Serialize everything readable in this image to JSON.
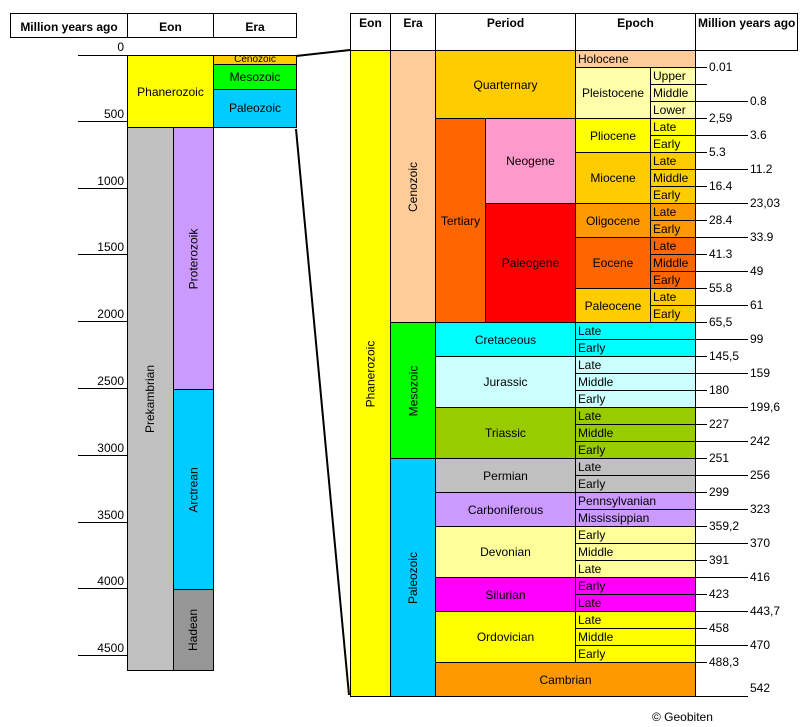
{
  "left": {
    "headers": [
      "Million years ago",
      "Eon",
      "Era"
    ],
    "ticks": [
      0,
      500,
      1000,
      1500,
      2000,
      2500,
      3000,
      3500,
      4000,
      4500
    ],
    "eons": [
      {
        "name": "Phanerozoic",
        "from": 0,
        "to": 542,
        "color": "#FFFF00"
      },
      {
        "name": "Prekambrian",
        "from": 542,
        "to": 4600,
        "color": "#C0C0C0",
        "vertical": true
      }
    ],
    "subeons": [
      {
        "name": "Proterozoik",
        "from": 542,
        "to": 2500,
        "color": "#CC99FF"
      },
      {
        "name": "Arctrean",
        "from": 2500,
        "to": 4000,
        "color": "#00CCFF"
      },
      {
        "name": "Hadean",
        "from": 4000,
        "to": 4600,
        "color": "#969696"
      }
    ],
    "eras": [
      {
        "name": "Cenozoic",
        "from": 0,
        "to": 65.5,
        "color": "#FFCC00"
      },
      {
        "name": "Mesozoic",
        "from": 65.5,
        "to": 251,
        "color": "#00FF00"
      },
      {
        "name": "Paleozoic",
        "from": 251,
        "to": 542,
        "color": "#00CCFF"
      }
    ]
  },
  "right": {
    "headers": {
      "eon": "Eon",
      "era": "Era",
      "period": "Period",
      "epoch": "Epoch",
      "mya": "Million years ago"
    },
    "eon": {
      "name": "Phanerozoic",
      "color": "#FFFF00"
    },
    "eras": [
      {
        "name": "Cenozoic",
        "color": "#FFCC99",
        "periods": [
          {
            "name": "Quarternary",
            "color": "#FFCC00",
            "epochs": [
              {
                "name": "Holocene",
                "color": "#FFCC99",
                "subs": []
              },
              {
                "name": "Pleistocene",
                "color": "#FFFFAA",
                "subs": [
                  "Upper",
                  "Middle",
                  "Lower"
                ]
              }
            ]
          },
          {
            "name": "Neogene",
            "group": "Tertiary",
            "groupColor": "#FF6600",
            "color": "#FF99CC",
            "epochs": [
              {
                "name": "Pliocene",
                "color": "#FFFF00",
                "subs": [
                  "Late",
                  "Early"
                ]
              },
              {
                "name": "Miocene",
                "color": "#FFCC00",
                "subs": [
                  "Late",
                  "Middle",
                  "Early"
                ]
              }
            ]
          },
          {
            "name": "Paleogene",
            "group": "Tertiary",
            "groupColor": "#FF6600",
            "color": "#FF0000",
            "epochs": [
              {
                "name": "Oligocene",
                "color": "#FF9900",
                "subs": [
                  "Late",
                  "Early"
                ]
              },
              {
                "name": "Eocene",
                "color": "#FF6600",
                "subs": [
                  "Late",
                  "Middle",
                  "Early"
                ]
              },
              {
                "name": "Paleocene",
                "color": "#FFCC00",
                "subs": [
                  "Late",
                  "Early"
                ]
              }
            ]
          }
        ]
      },
      {
        "name": "Mesozoic",
        "color": "#00FF00",
        "periods": [
          {
            "name": "Cretaceous",
            "color": "#00FFFF",
            "stages": [
              "Late",
              "Early"
            ]
          },
          {
            "name": "Jurassic",
            "color": "#CCFFFF",
            "stages": [
              "Late",
              "Middle",
              "Early"
            ]
          },
          {
            "name": "Triassic",
            "color": "#99CC00",
            "stages": [
              "Late",
              "Middle",
              "Early"
            ]
          }
        ]
      },
      {
        "name": "Paleozoic",
        "color": "#00CCFF",
        "periods": [
          {
            "name": "Permian",
            "color": "#C0C0C0",
            "stages": [
              "Late",
              "Early"
            ]
          },
          {
            "name": "Carboniferous",
            "color": "#CC99FF",
            "stages": [
              "Pennsylvanian",
              "Mississippian"
            ]
          },
          {
            "name": "Devonian",
            "color": "#FFFF99",
            "stages": [
              "Early",
              "Middle",
              "Late"
            ]
          },
          {
            "name": "Silurian",
            "color": "#FF00FF",
            "stages": [
              "Early",
              "Late"
            ]
          },
          {
            "name": "Ordovician",
            "color": "#FFFF00",
            "stages": [
              "Late",
              "Middle",
              "Early"
            ]
          },
          {
            "name": "Cambrian",
            "color": "#FF9900",
            "stages": []
          }
        ]
      }
    ],
    "mya_labels": [
      "0.01",
      "",
      "0.8",
      "2,59",
      "3.6",
      "5.3",
      "11.2",
      "16.4",
      "23,03",
      "28.4",
      "33.9",
      "41.3",
      "49",
      "55.8",
      "61",
      "65,5",
      "99",
      "145,5",
      "159",
      "180",
      "199,6",
      "227",
      "242",
      "251",
      "256",
      "299",
      "323",
      "359,2",
      "370",
      "391",
      "416",
      "423",
      "443,7",
      "458",
      "470",
      "488,3",
      "",
      "542"
    ]
  },
  "copyright": "© Geobiten"
}
